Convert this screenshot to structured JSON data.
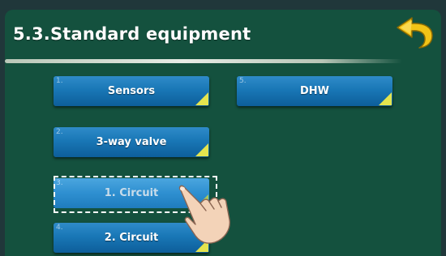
{
  "header": {
    "title": "5.3.Standard equipment",
    "back_icon": "back-arrow-icon"
  },
  "menu": {
    "items": [
      {
        "number": "1.",
        "label": "Sensors"
      },
      {
        "number": "2.",
        "label": "3-way valve"
      },
      {
        "number": "3.",
        "label": "1. Circuit",
        "selected": true
      },
      {
        "number": "4.",
        "label": "2. Circuit"
      },
      {
        "number": "5.",
        "label": "DHW"
      }
    ]
  },
  "colors": {
    "panel": "#14513e",
    "tile": "#1977b6",
    "accent_corner": "#e4e44e",
    "back_arrow": "#f2c417"
  },
  "pointer_icon": "pointing-hand-icon"
}
